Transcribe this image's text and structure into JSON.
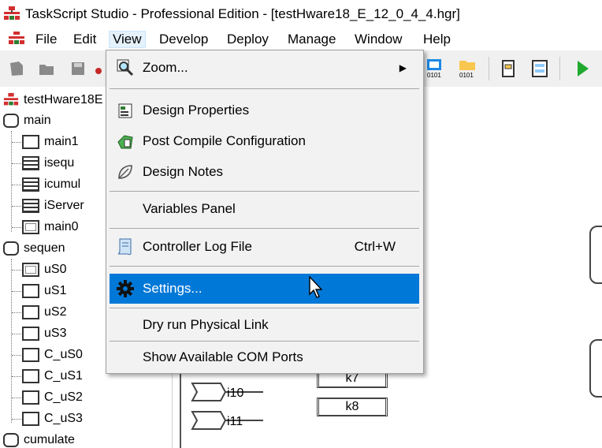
{
  "window": {
    "title": "TaskScript Studio - Professional Edition - [testHware18_E_12_0_4_4.hgr]"
  },
  "menubar": {
    "items": [
      "File",
      "Edit",
      "View",
      "Develop",
      "Deploy",
      "Manage",
      "Window",
      "Help"
    ],
    "active": "View"
  },
  "view_menu": {
    "items": [
      {
        "label": "Zoom...",
        "shortcut": "",
        "has_submenu": true,
        "icon": "zoom-icon"
      },
      {
        "label": "Design Properties",
        "shortcut": "",
        "icon": "design-properties-icon"
      },
      {
        "label": "Post Compile Configuration",
        "shortcut": "",
        "icon": "post-compile-icon"
      },
      {
        "label": "Design Notes",
        "shortcut": "",
        "icon": "leaf-notes-icon"
      },
      {
        "label": "Variables Panel",
        "shortcut": ""
      },
      {
        "label": "Controller Log File",
        "shortcut": "Ctrl+W",
        "icon": "log-file-icon"
      },
      {
        "label": "Settings...",
        "shortcut": "",
        "icon": "gear-icon",
        "highlighted": true
      },
      {
        "label": "Dry run Physical Link",
        "shortcut": ""
      },
      {
        "label": "Show Available COM Ports",
        "shortcut": ""
      }
    ]
  },
  "tree": {
    "root": "testHware18E",
    "nodes": [
      {
        "label": "main",
        "kind": "group"
      },
      {
        "label": "main1",
        "kind": "box"
      },
      {
        "label": "isequ",
        "kind": "striped"
      },
      {
        "label": "icumul",
        "kind": "striped"
      },
      {
        "label": "iServer",
        "kind": "striped"
      },
      {
        "label": "main0",
        "kind": "inner"
      },
      {
        "label": "sequen",
        "kind": "group"
      },
      {
        "label": "uS0",
        "kind": "inner"
      },
      {
        "label": "uS1",
        "kind": "box"
      },
      {
        "label": "uS2",
        "kind": "box"
      },
      {
        "label": "uS3",
        "kind": "box"
      },
      {
        "label": "C_uS0",
        "kind": "box"
      },
      {
        "label": "C_uS1",
        "kind": "box"
      },
      {
        "label": "C_uS2",
        "kind": "box"
      },
      {
        "label": "C_uS3",
        "kind": "box"
      },
      {
        "label": "cumulate",
        "kind": "group"
      }
    ]
  },
  "canvas": {
    "inputs": [
      "i10",
      "i11"
    ],
    "blocks": [
      "k7",
      "k8"
    ]
  },
  "toolbar": {
    "icons": [
      "new-icon",
      "open-icon",
      "save-icon",
      "cut-icon",
      "compile-icon",
      "download-icon",
      "module-icon",
      "panel-icon",
      "run-icon"
    ],
    "labels": {
      "compile": "0101",
      "download": "0101"
    }
  }
}
